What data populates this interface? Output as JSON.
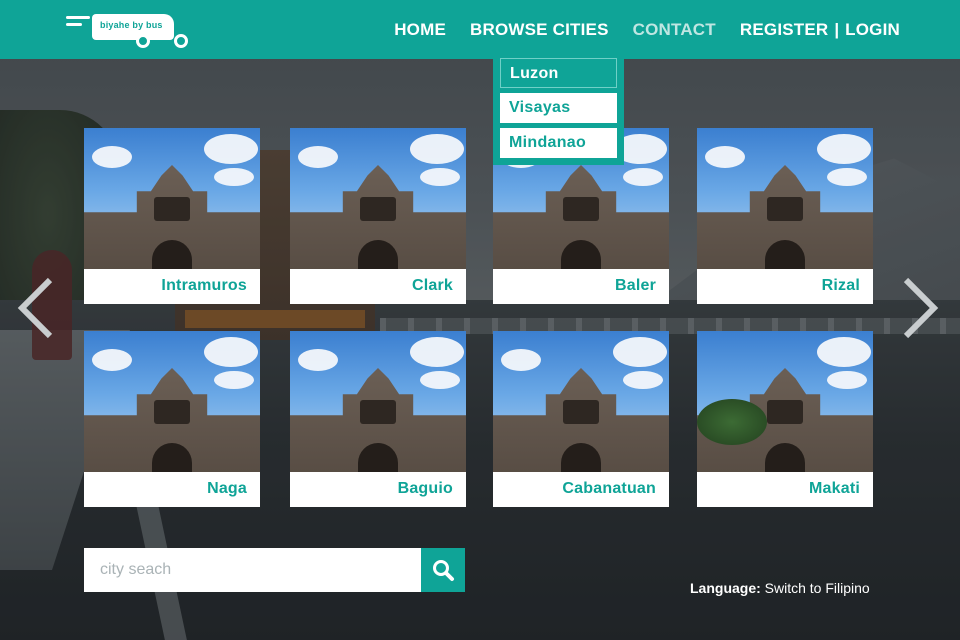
{
  "brand": {
    "logo_text": "biyahe by bus"
  },
  "nav": {
    "home": "HOME",
    "browse": "BROWSE CITIES",
    "contact": "CONTACT",
    "register": "REGISTER",
    "separator": "|",
    "login": "LOGIN"
  },
  "dropdown": {
    "items": [
      {
        "label": "Luzon",
        "state": "highlighted"
      },
      {
        "label": "Visayas",
        "state": "normal"
      },
      {
        "label": "Mindanao",
        "state": "normal"
      }
    ]
  },
  "cities": [
    {
      "name": "Intramuros"
    },
    {
      "name": "Clark"
    },
    {
      "name": "Baler"
    },
    {
      "name": "Rizal"
    },
    {
      "name": "Naga"
    },
    {
      "name": "Baguio"
    },
    {
      "name": "Cabanatuan"
    },
    {
      "name": "Makati"
    }
  ],
  "search": {
    "placeholder": "city seach"
  },
  "language": {
    "key": "Language:",
    "link": "Switch to Filipino"
  },
  "colors": {
    "accent": "#0fa497",
    "muted_nav": "#bfe6e2"
  }
}
